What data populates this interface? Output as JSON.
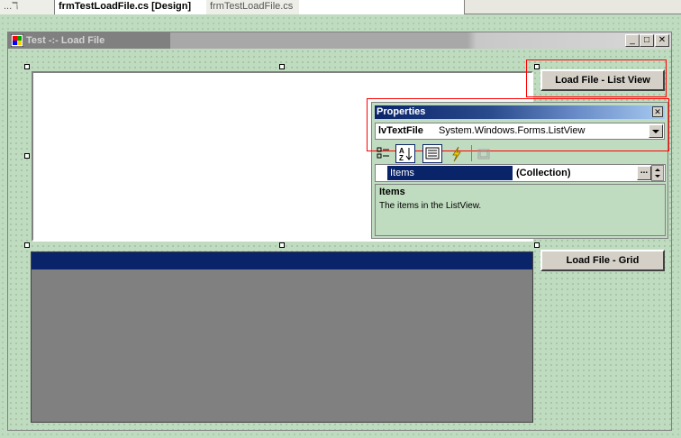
{
  "tabs": [
    {
      "label": "...ℸ"
    },
    {
      "label": "frmTestLoadFile.cs [Design]"
    },
    {
      "label": "frmTestLoadFile.cs"
    }
  ],
  "form": {
    "title": "Test -:- Load File",
    "minimize_glyph": "_",
    "maximize_glyph": "□",
    "close_glyph": "✕"
  },
  "buttons": {
    "load_list_view": "Load File - List View",
    "load_grid": "Load File - Grid"
  },
  "properties": {
    "title": "Properties",
    "close_glyph": "✕",
    "object_name": "lvTextFile",
    "object_type": "System.Windows.Forms.ListView",
    "row_name": "Items",
    "row_value": "(Collection)",
    "ellipsis": "...",
    "desc_title": "Items",
    "desc_text": "The items in the ListView."
  },
  "colors": {
    "design_surface": "#c0dcc0",
    "selection_highlight": "#0a246a",
    "grid_background": "#808080",
    "annotation_red": "#ff0000"
  }
}
